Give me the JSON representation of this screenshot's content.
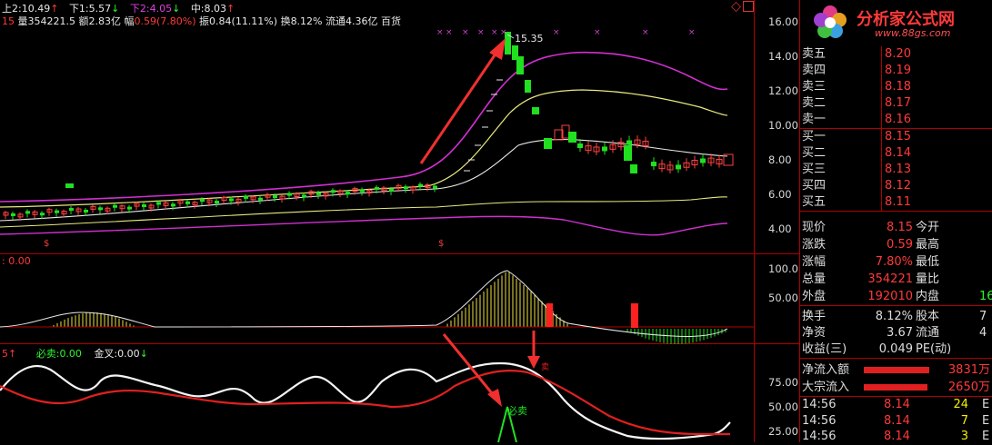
{
  "header": {
    "up2_label": "上2:",
    "up2_val": "10.49",
    "down1_label": "下1:",
    "down1_val": "5.57",
    "down2_label": "下2:",
    "down2_val": "4.05",
    "mid_label": "中:",
    "mid_val": "8.03",
    "info_prefix": "15",
    "vol_label": "量",
    "vol_val": "354221.5",
    "amt_label": "额",
    "amt_val": "2.83亿",
    "chg_label": "幅",
    "chg_val": "0.59(7.80%)",
    "amp_label": "振",
    "amp_val": "0.84(11.11%)",
    "turn_label": "换",
    "turn_val": "8.12%",
    "float_label": "流通",
    "float_val": "4.36亿",
    "sector": "百货"
  },
  "price_axis": [
    "16.00",
    "14.00",
    "12.00",
    "10.00",
    "8.00",
    "6.00",
    "4.00"
  ],
  "peak_label": "15.35",
  "mid_panel": {
    "label": ": 0.00",
    "axis": [
      "100.0",
      "50.00"
    ]
  },
  "low_panel": {
    "prefix": "5",
    "sell_label": "必卖:",
    "sell_val": "0.00",
    "cross_label": "金叉:",
    "cross_val": "0.00",
    "axis": [
      "75.00",
      "50.00",
      "25.00"
    ],
    "signal_text": "必卖",
    "small_text": "卖"
  },
  "logo": {
    "title": "分析家公式网",
    "url": "www.88gs.com"
  },
  "order_book": [
    {
      "label": "卖五",
      "price": "8.20"
    },
    {
      "label": "卖四",
      "price": "8.19"
    },
    {
      "label": "卖三",
      "price": "8.18"
    },
    {
      "label": "卖二",
      "price": "8.17"
    },
    {
      "label": "卖一",
      "price": "8.16"
    },
    {
      "label": "买一",
      "price": "8.15"
    },
    {
      "label": "买二",
      "price": "8.14"
    },
    {
      "label": "买三",
      "price": "8.13"
    },
    {
      "label": "买四",
      "price": "8.12"
    },
    {
      "label": "买五",
      "price": "8.11"
    }
  ],
  "quote": [
    {
      "l": "现价",
      "v": "8.15",
      "r": "今开",
      "rv": ""
    },
    {
      "l": "涨跌",
      "v": "0.59",
      "r": "最高",
      "rv": ""
    },
    {
      "l": "涨幅",
      "v": "7.80%",
      "r": "最低",
      "rv": ""
    },
    {
      "l": "总量",
      "v": "354221",
      "r": "量比",
      "rv": ""
    },
    {
      "l": "外盘",
      "v": "192010",
      "r": "内盘",
      "rv": "16"
    }
  ],
  "stats": [
    {
      "l": "换手",
      "v": "8.12%",
      "r": "股本",
      "rv": "7"
    },
    {
      "l": "净资",
      "v": "3.67",
      "r": "流通",
      "rv": "4"
    },
    {
      "l": "收益(三)",
      "v": "0.049",
      "r": "PE(动)",
      "rv": ""
    }
  ],
  "flow": [
    {
      "l": "净流入额",
      "v": "3831万"
    },
    {
      "l": "大宗流入",
      "v": "2650万"
    }
  ],
  "ticks": [
    {
      "t": "14:56",
      "p": "8.14",
      "q": "24",
      "d": "E"
    },
    {
      "t": "14:56",
      "p": "8.14",
      "q": "7",
      "d": "E"
    },
    {
      "t": "14:56",
      "p": "8.14",
      "q": "3",
      "d": "E"
    }
  ]
}
